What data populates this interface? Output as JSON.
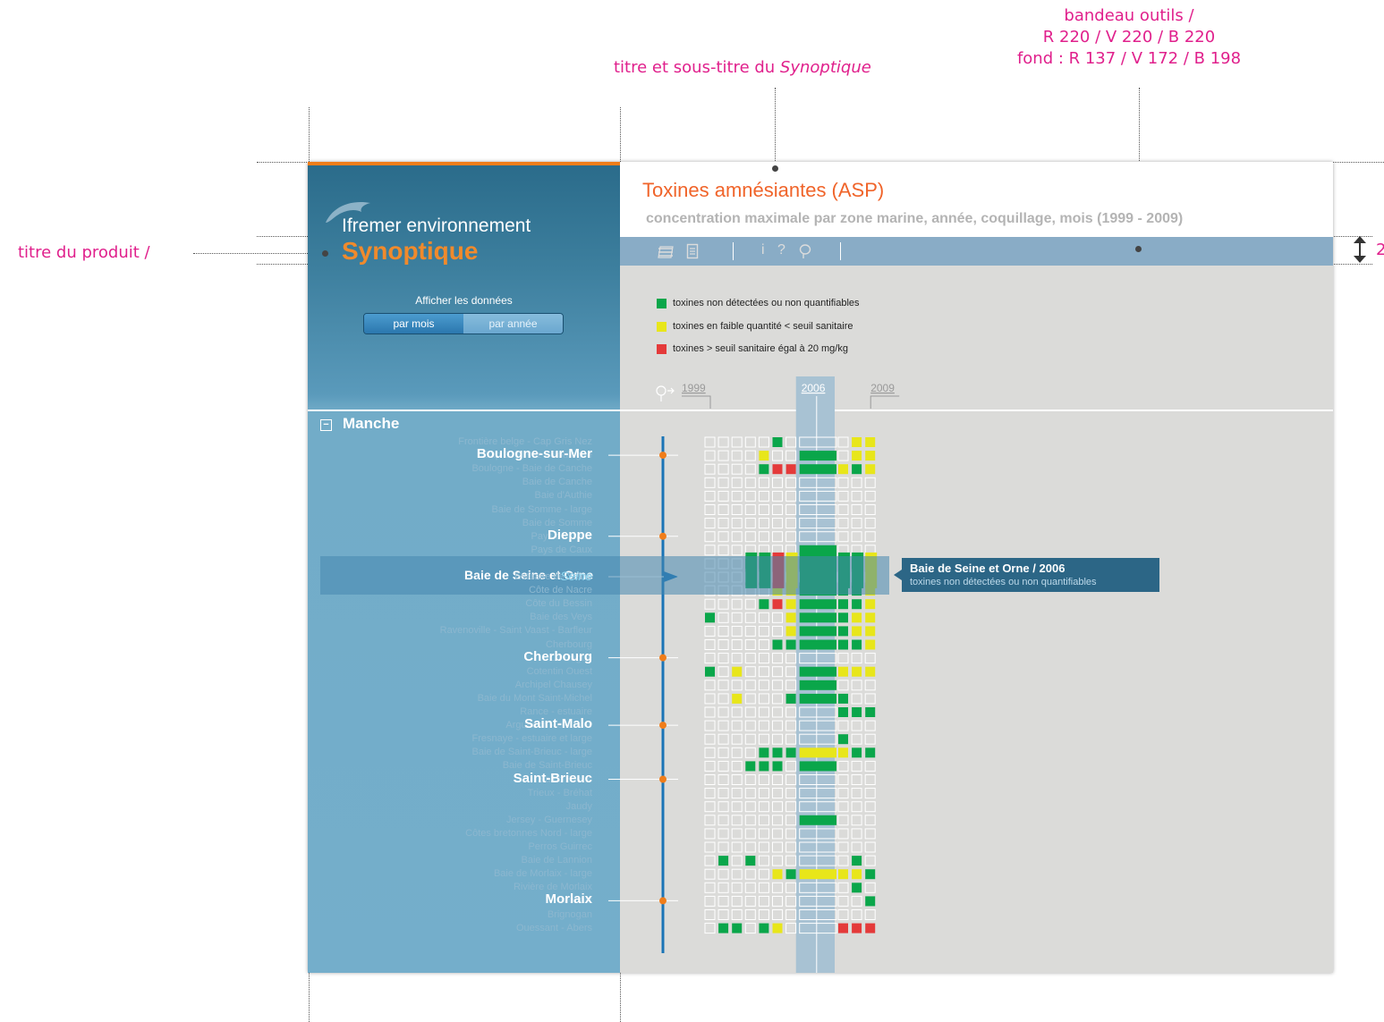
{
  "annotations": {
    "header_note": [
      "titre et sous-titre du ",
      "Synoptique"
    ],
    "toolbar_note": [
      "bandeau outils /",
      "R 220 / V 220 / B 220",
      "fond : R 137 / V 172 / B 198"
    ],
    "product_note": "titre du produit /",
    "height_note": "2"
  },
  "sidebar": {
    "brand": "Ifremer environnement",
    "product_title": "Synoptique",
    "display_label": "Afficher les données",
    "toggle": {
      "by_month": "par mois",
      "by_year": "par année"
    }
  },
  "header": {
    "title": "Toxines amnésiantes (ASP)",
    "subtitle": "concentration maximale par zone marine, année, coquillage, mois (1999 - 2009)"
  },
  "toolbar": {
    "icons": [
      "layers-icon",
      "document-icon",
      "info-icon",
      "help-icon",
      "comment-icon"
    ]
  },
  "legend": [
    {
      "label": "toxines non détectées ou non quantifiables",
      "color": "#0aa64a"
    },
    {
      "label": "toxines en faible quantité < seuil sanitaire",
      "color": "#e8e61a"
    },
    {
      "label": "toxines > seuil sanitaire égal à 20 mg/kg",
      "color": "#e43a3a"
    }
  ],
  "timeline": {
    "start": "1999",
    "selected": "2006",
    "end": "2009"
  },
  "region": {
    "name": "Manche"
  },
  "zones": [
    "Frontière belge - Cap Gris Nez",
    "Cap Gris Nez - Boulogne",
    "Boulogne - Baie de Canche",
    "Baie de Canche",
    "Baie d'Authie",
    "Baie de Somme - large",
    "Baie de Somme",
    "Pays de Caux",
    "Pays de Caux",
    "Baie de Seine et Orne",
    "Estuaire de Seine",
    "Côte de Nacre",
    "Côte du Bessin",
    "Baie des Veys",
    "Ravenoville - Saint Vaast - Barfleur",
    "Cherbourg",
    "La Hague",
    "Cotentin Ouest",
    "Archipel Chausey",
    "Baie du Mont Saint-Michel",
    "Rance - estuaire",
    "Arguenon - estuaire",
    "Fresnaye - estuaire et large",
    "Baie de Saint-Brieuc - large",
    "Baie de Saint-Brieuc",
    "Saint-Brieuc",
    "Trieux - Bréhat",
    "Jaudy",
    "Jersey - Guernesey",
    "Côtes bretonnes Nord - large",
    "Perros Guirrec",
    "Baie de Lannion",
    "Baie de Morlaix - large",
    "Rivière de Morlaix",
    "Morlaix",
    "Brignogan",
    "Ouessant - Abers"
  ],
  "cities": [
    {
      "name": "Boulogne-sur-Mer",
      "row": 1
    },
    {
      "name": "Dieppe",
      "row": 7
    },
    {
      "name": "Seine",
      "row": 10
    },
    {
      "name": "Cherbourg",
      "row": 16
    },
    {
      "name": "Saint-Malo",
      "row": 21
    },
    {
      "name": "Saint-Brieuc",
      "row": 25
    },
    {
      "name": "Morlaix",
      "row": 34
    }
  ],
  "highlight": {
    "zone": "Baie de Seine et Orne",
    "row": 9
  },
  "tooltip": {
    "title": "Baie de Seine et Orne / 2006",
    "text": "toxines non détectées ou non quantifiables"
  },
  "chart_data": {
    "type": "heatmap",
    "years": [
      "1999",
      "2000",
      "2001",
      "2002",
      "2003",
      "2004",
      "2005",
      "2006",
      "2007",
      "2008",
      "2009"
    ],
    "states": {
      "0": "pas de donnée",
      "1": "toxines non détectées ou non quantifiables",
      "2": "toxines en faible quantité < seuil sanitaire",
      "3": "toxines > seuil sanitaire égal à 20 mg/kg"
    },
    "rows": [
      [
        0,
        0,
        0,
        0,
        0,
        1,
        0,
        0,
        0,
        2,
        2
      ],
      [
        0,
        0,
        0,
        0,
        2,
        0,
        0,
        1,
        0,
        2,
        2
      ],
      [
        0,
        0,
        0,
        0,
        1,
        3,
        3,
        1,
        2,
        1,
        2
      ],
      [
        0,
        0,
        0,
        0,
        0,
        0,
        0,
        0,
        0,
        0,
        0
      ],
      [
        0,
        0,
        0,
        0,
        0,
        0,
        0,
        0,
        0,
        0,
        0
      ],
      [
        0,
        0,
        0,
        0,
        0,
        0,
        0,
        0,
        0,
        0,
        0
      ],
      [
        0,
        0,
        0,
        0,
        0,
        0,
        0,
        0,
        0,
        0,
        0
      ],
      [
        0,
        0,
        0,
        0,
        0,
        0,
        0,
        0,
        0,
        0,
        0
      ],
      [
        0,
        0,
        0,
        0,
        0,
        0,
        0,
        1,
        0,
        0,
        0
      ],
      [
        0,
        0,
        0,
        1,
        1,
        3,
        2,
        1,
        1,
        1,
        2
      ],
      [
        0,
        0,
        0,
        0,
        0,
        0,
        0,
        0,
        0,
        0,
        0
      ],
      [
        0,
        0,
        0,
        0,
        0,
        2,
        2,
        1,
        1,
        1,
        2
      ],
      [
        0,
        0,
        0,
        0,
        1,
        3,
        2,
        1,
        1,
        1,
        2
      ],
      [
        1,
        0,
        0,
        0,
        0,
        0,
        2,
        1,
        1,
        2,
        2
      ],
      [
        0,
        0,
        0,
        0,
        0,
        0,
        2,
        1,
        1,
        2,
        2
      ],
      [
        0,
        0,
        0,
        0,
        0,
        1,
        1,
        1,
        1,
        1,
        2
      ],
      [
        0,
        0,
        0,
        0,
        0,
        0,
        0,
        0,
        0,
        0,
        0
      ],
      [
        1,
        0,
        2,
        0,
        0,
        0,
        0,
        1,
        2,
        2,
        2
      ],
      [
        0,
        0,
        0,
        0,
        0,
        0,
        0,
        1,
        0,
        0,
        0
      ],
      [
        0,
        0,
        2,
        0,
        0,
        0,
        1,
        1,
        1,
        0,
        0
      ],
      [
        0,
        0,
        0,
        0,
        0,
        0,
        0,
        0,
        1,
        1,
        1
      ],
      [
        0,
        0,
        0,
        0,
        0,
        0,
        0,
        0,
        0,
        0,
        0
      ],
      [
        0,
        0,
        0,
        0,
        0,
        0,
        0,
        0,
        1,
        0,
        0
      ],
      [
        0,
        0,
        0,
        0,
        1,
        1,
        1,
        2,
        2,
        1,
        1
      ],
      [
        0,
        0,
        0,
        1,
        1,
        1,
        0,
        1,
        0,
        0,
        0
      ],
      [
        0,
        0,
        0,
        0,
        0,
        0,
        0,
        0,
        0,
        0,
        0
      ],
      [
        0,
        0,
        0,
        0,
        0,
        0,
        0,
        0,
        0,
        0,
        0
      ],
      [
        0,
        0,
        0,
        0,
        0,
        0,
        0,
        0,
        0,
        0,
        0
      ],
      [
        0,
        0,
        0,
        0,
        0,
        0,
        0,
        1,
        0,
        0,
        0
      ],
      [
        0,
        0,
        0,
        0,
        0,
        0,
        0,
        0,
        0,
        0,
        0
      ],
      [
        0,
        0,
        0,
        0,
        0,
        0,
        0,
        0,
        0,
        0,
        0
      ],
      [
        0,
        1,
        0,
        1,
        0,
        0,
        0,
        0,
        0,
        1,
        0
      ],
      [
        0,
        0,
        0,
        0,
        0,
        2,
        1,
        2,
        2,
        2,
        1
      ],
      [
        0,
        0,
        0,
        0,
        0,
        0,
        0,
        0,
        0,
        1,
        0
      ],
      [
        0,
        0,
        0,
        0,
        0,
        0,
        0,
        0,
        0,
        0,
        1
      ],
      [
        0,
        0,
        0,
        0,
        0,
        0,
        0,
        0,
        0,
        0,
        0
      ],
      [
        0,
        1,
        1,
        0,
        1,
        2,
        0,
        0,
        3,
        3,
        3
      ]
    ]
  }
}
